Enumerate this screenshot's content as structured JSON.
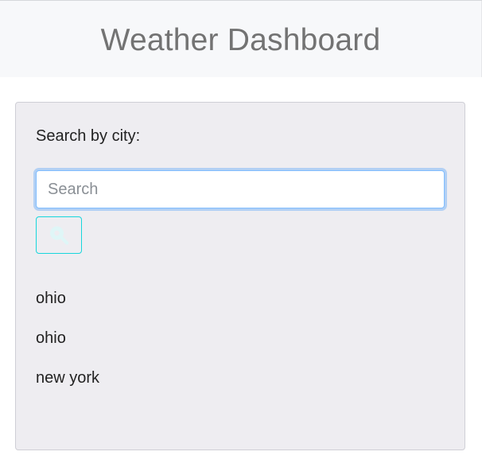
{
  "header": {
    "title": "Weather Dashboard"
  },
  "search": {
    "label": "Search by city:",
    "placeholder": "Search",
    "value": "",
    "button_icon": "search-icon"
  },
  "history": {
    "items": [
      {
        "label": "ohio"
      },
      {
        "label": "ohio"
      },
      {
        "label": "new york"
      }
    ]
  },
  "colors": {
    "header_background": "#f7f8fa",
    "title_text": "#737373",
    "card_background": "#eeedf1",
    "input_focus_border": "#80bdff",
    "button_border": "#17d6dc",
    "button_icon": "#dff6f7"
  }
}
